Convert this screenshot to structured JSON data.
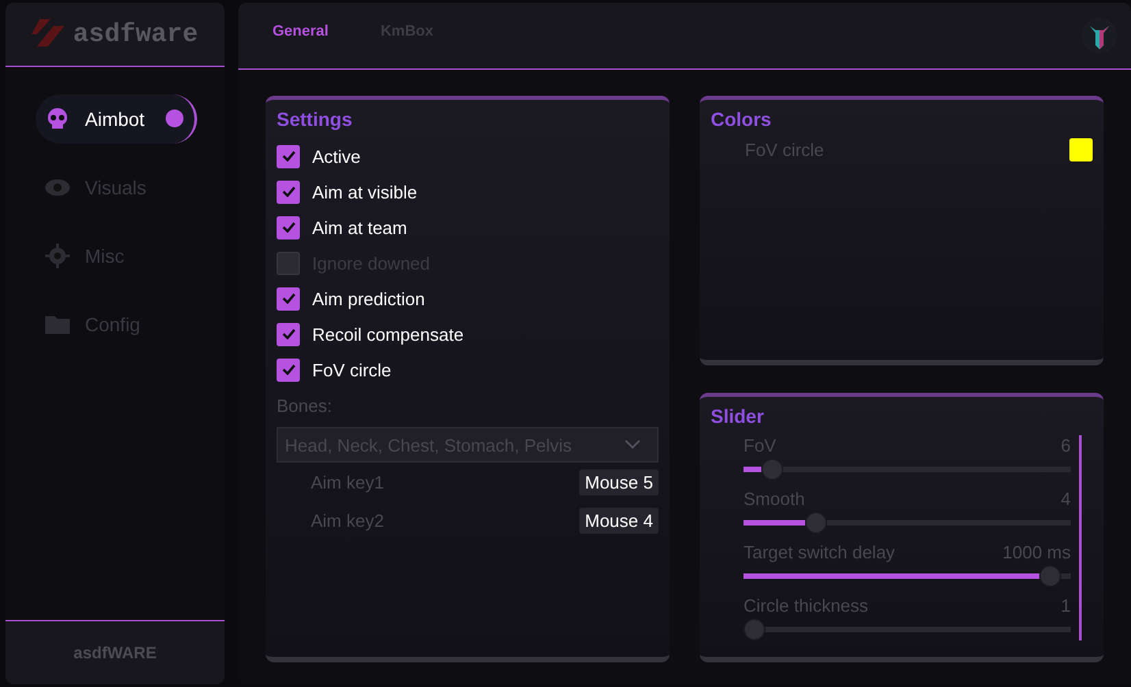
{
  "brand": {
    "logo": "asdfware",
    "footer": "asdfWARE"
  },
  "sidebar": {
    "items": [
      {
        "label": "Aimbot",
        "selected": true
      },
      {
        "label": "Visuals",
        "selected": false
      },
      {
        "label": "Misc",
        "selected": false
      },
      {
        "label": "Config",
        "selected": false
      }
    ]
  },
  "tabs": [
    {
      "label": "General",
      "selected": true
    },
    {
      "label": "KmBox",
      "selected": false
    }
  ],
  "settings": {
    "title": "Settings",
    "checkboxes": [
      {
        "label": "Active",
        "checked": true,
        "disabled": false
      },
      {
        "label": "Aim at visible",
        "checked": true,
        "disabled": false
      },
      {
        "label": "Aim at team",
        "checked": true,
        "disabled": false
      },
      {
        "label": "Ignore downed",
        "checked": false,
        "disabled": true
      },
      {
        "label": "Aim prediction",
        "checked": true,
        "disabled": false
      },
      {
        "label": "Recoil compensate",
        "checked": true,
        "disabled": false
      },
      {
        "label": "FoV circle",
        "checked": true,
        "disabled": false
      }
    ],
    "bones_label": "Bones:",
    "bones_value": "Head, Neck, Chest, Stomach, Pelvis",
    "keys": [
      {
        "label": "Aim key1",
        "value": "Mouse 5"
      },
      {
        "label": "Aim key2",
        "value": "Mouse 4"
      }
    ]
  },
  "colors": {
    "title": "Colors",
    "items": [
      {
        "label": "FoV circle",
        "color": "#ffff00"
      }
    ]
  },
  "sliders": {
    "title": "Slider",
    "items": [
      {
        "label": "FoV",
        "reading": "6",
        "level": 0.06
      },
      {
        "label": "Smooth",
        "reading": "4",
        "level": 0.2
      },
      {
        "label": "Target switch delay",
        "reading": "1000 ms",
        "level": 0.97
      },
      {
        "label": "Circle thickness",
        "reading": "1",
        "level": 0.0
      }
    ]
  }
}
